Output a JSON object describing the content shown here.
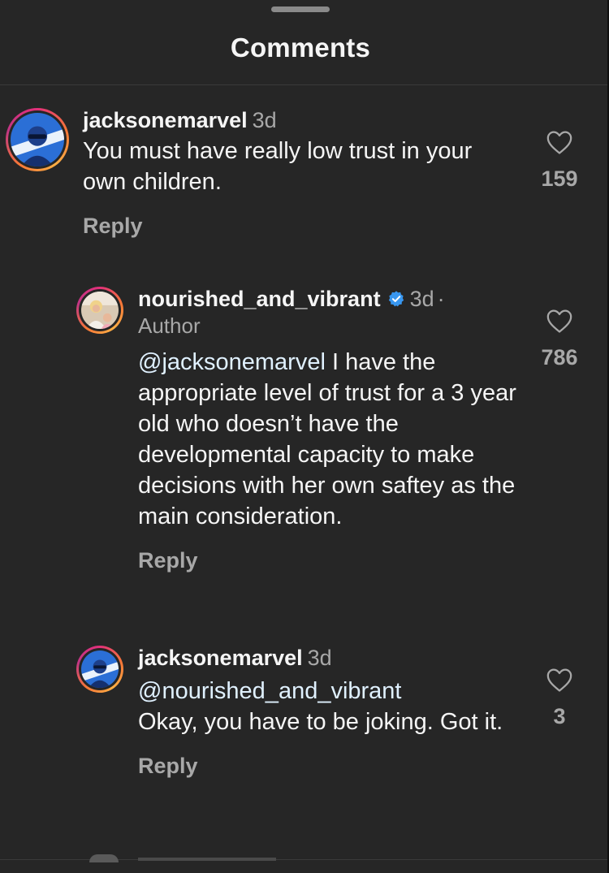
{
  "sheet": {
    "title": "Comments"
  },
  "comments": [
    {
      "username": "jacksonemarvel",
      "time": "3d",
      "text": "You must have really low trust in your own children.",
      "reply_label": "Reply",
      "likes": "159"
    },
    {
      "username": "nourished_and_vibrant",
      "time": "3d",
      "dot": "·",
      "author_label": "Author",
      "mention": "@jacksonemarvel",
      "text": " I have the appropriate level of trust for a 3 year old who doesn’t have the developmental capacity to make decisions with her own saftey as the main consideration.",
      "reply_label": "Reply",
      "likes": "786",
      "verified": true
    },
    {
      "username": "jacksonemarvel",
      "time": "3d",
      "mention": "@nourished_and_vibrant",
      "text": "Okay, you have to be joking. Got it.",
      "reply_label": "Reply",
      "likes": "3"
    }
  ],
  "colors": {
    "background": "#262626",
    "primary_text": "#f5f5f5",
    "secondary_text": "#a8a8a8",
    "mention": "#e0f1ff",
    "verified": "#3897f0"
  },
  "icons": {
    "like": "heart-outline-icon",
    "verified": "verified-badge-icon"
  }
}
